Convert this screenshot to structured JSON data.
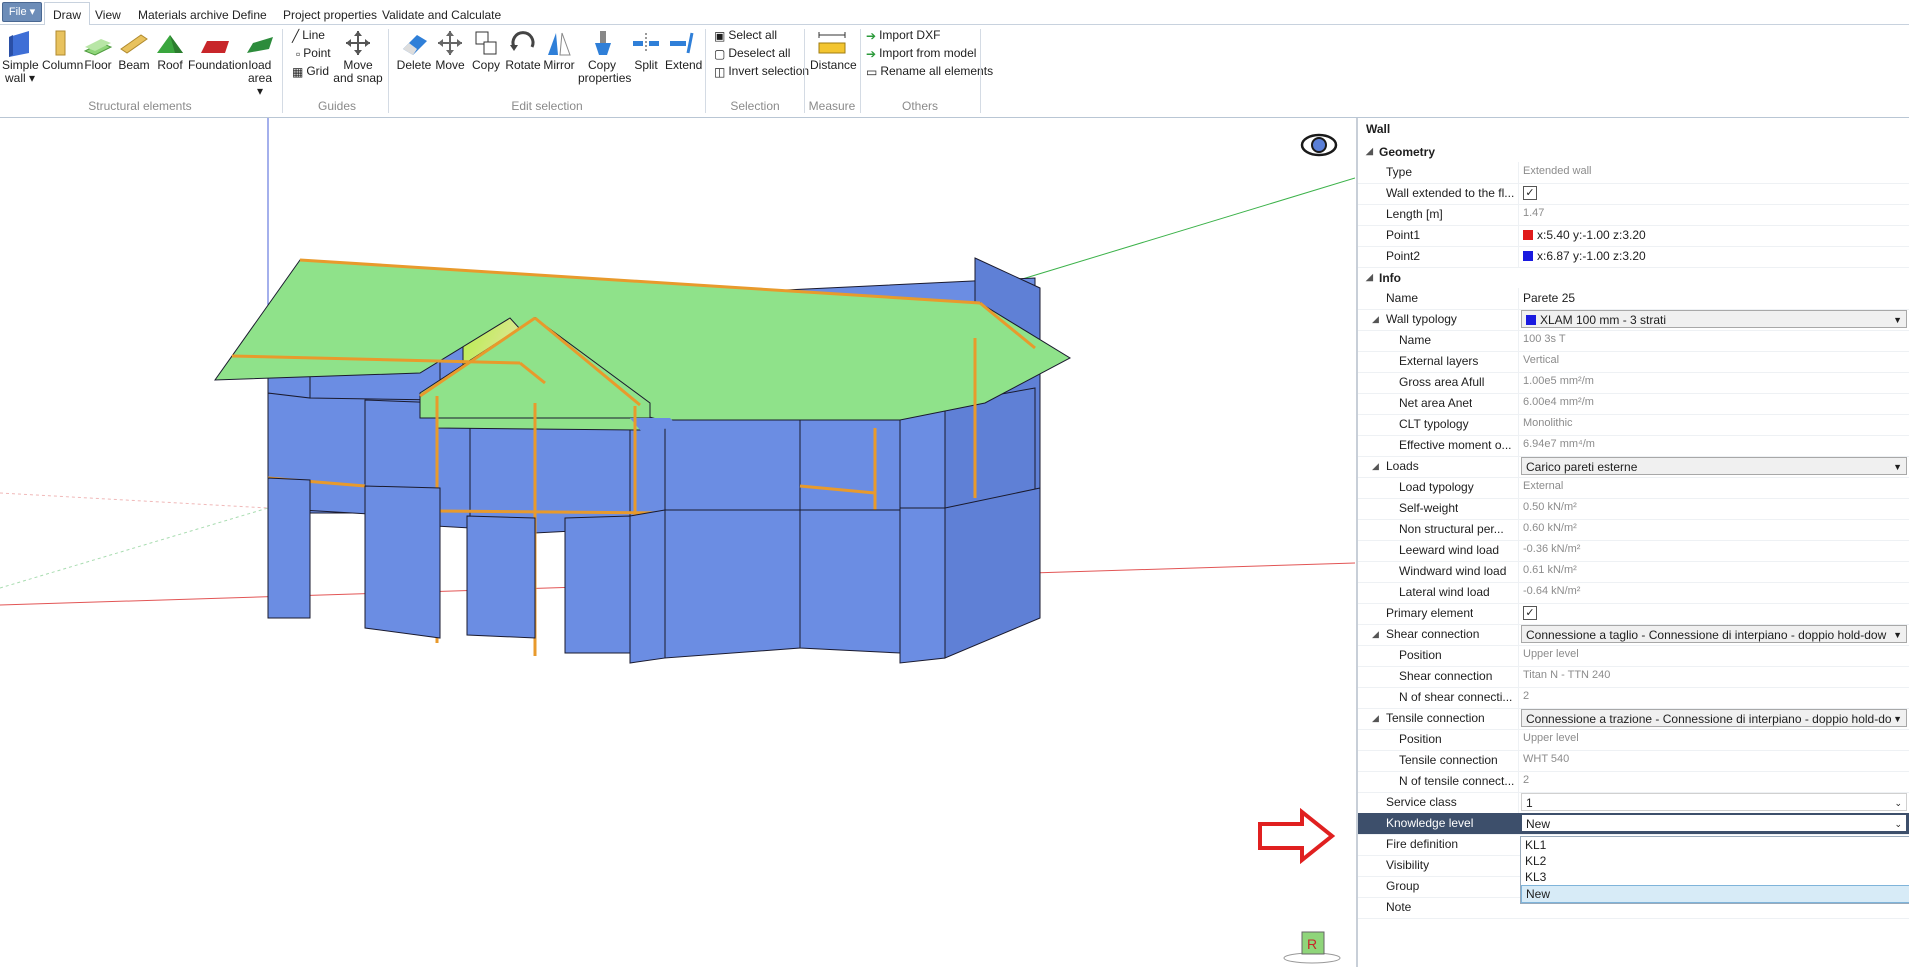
{
  "file_menu": "File",
  "tabs": [
    "Draw",
    "View",
    "Materials archive",
    "Define",
    "Project properties",
    "Validate and Calculate"
  ],
  "ribbon": {
    "structural": [
      "Simple wall",
      "Column",
      "Floor",
      "Beam",
      "Roof",
      "Foundation",
      "load area"
    ],
    "structural_label": "Structural elements",
    "guides": [
      "Line",
      "Point",
      "Grid"
    ],
    "move_snap": "Move and snap",
    "guides_label": "Guides",
    "edit": [
      "Delete",
      "Move",
      "Copy",
      "Rotate",
      "Mirror",
      "Copy properties",
      "Split",
      "Extend"
    ],
    "edit_label": "Edit selection",
    "selection": [
      "Select all",
      "Deselect all",
      "Invert selection"
    ],
    "selection_label": "Selection",
    "measure": "Distance",
    "measure_label": "Measure",
    "others": [
      "Import DXF",
      "Import from model",
      "Rename all elements"
    ],
    "others_label": "Others"
  },
  "panel": {
    "title": "Wall",
    "geometry_label": "Geometry",
    "type_label": "Type",
    "type_value": "Extended wall",
    "extended_label": "Wall extended to the fl...",
    "length_label": "Length [m]",
    "length_value": "1.47",
    "point1_label": "Point1",
    "point1_value": "x:5.40 y:-1.00 z:3.20",
    "point2_label": "Point2",
    "point2_value": "x:6.87 y:-1.00 z:3.20",
    "info_label": "Info",
    "name_label": "Name",
    "name_value": "Parete 25",
    "typology_label": "Wall typology",
    "typology_value": "XLAM 100 mm - 3 strati",
    "t_name_label": "Name",
    "t_name_value": "100 3s T",
    "ext_layers_label": "External layers",
    "ext_layers_value": "Vertical",
    "gross_label": "Gross area Afull",
    "gross_value": "1.00e5 mm²/m",
    "net_label": "Net area Anet",
    "net_value": "6.00e4 mm²/m",
    "clt_label": "CLT typology",
    "clt_value": "Monolithic",
    "moment_label": "Effective moment o...",
    "moment_value": "6.94e7 mm⁴/m",
    "loads_label": "Loads",
    "loads_value": "Carico pareti esterne",
    "load_typ_label": "Load typology",
    "load_typ_value": "External",
    "self_label": "Self-weight",
    "self_value": "0.50 kN/m²",
    "nonstruct_label": "Non structural per...",
    "nonstruct_value": "0.60 kN/m²",
    "leeward_label": "Leeward wind load",
    "leeward_value": "-0.36 kN/m²",
    "windward_label": "Windward wind load",
    "windward_value": "0.61 kN/m²",
    "lateral_label": "Lateral wind load",
    "lateral_value": "-0.64 kN/m²",
    "primary_label": "Primary element",
    "shear_label": "Shear connection",
    "shear_value": "Connessione a taglio - Connessione di interpiano - doppio hold-dow",
    "s_pos_label": "Position",
    "s_pos_value": "Upper level",
    "s_conn_label": "Shear connection",
    "s_conn_value": "Titan N - TTN 240",
    "s_n_label": "N of shear connecti...",
    "s_n_value": "2",
    "tensile_label": "Tensile connection",
    "tensile_value": "Connessione a trazione - Connessione di interpiano - doppio hold-do",
    "t_pos_label": "Position",
    "t_pos_value": "Upper level",
    "t_conn_label": "Tensile connection",
    "t_conn_value": "WHT 540",
    "t_n_label": "N of tensile connect...",
    "t_n_value": "2",
    "service_label": "Service class",
    "service_value": "1",
    "knowledge_label": "Knowledge level",
    "knowledge_value": "New",
    "fire_label": "Fire definition",
    "visibility_label": "Visibility",
    "group_label": "Group",
    "note_label": "Note",
    "dropdown_options": [
      "KL1",
      "KL2",
      "KL3",
      "New"
    ]
  },
  "colors": {
    "wall": "#6b8de3",
    "roof": "#8fe28a",
    "beam": "#e89a2c",
    "selected_row": "#3d4f6b"
  }
}
